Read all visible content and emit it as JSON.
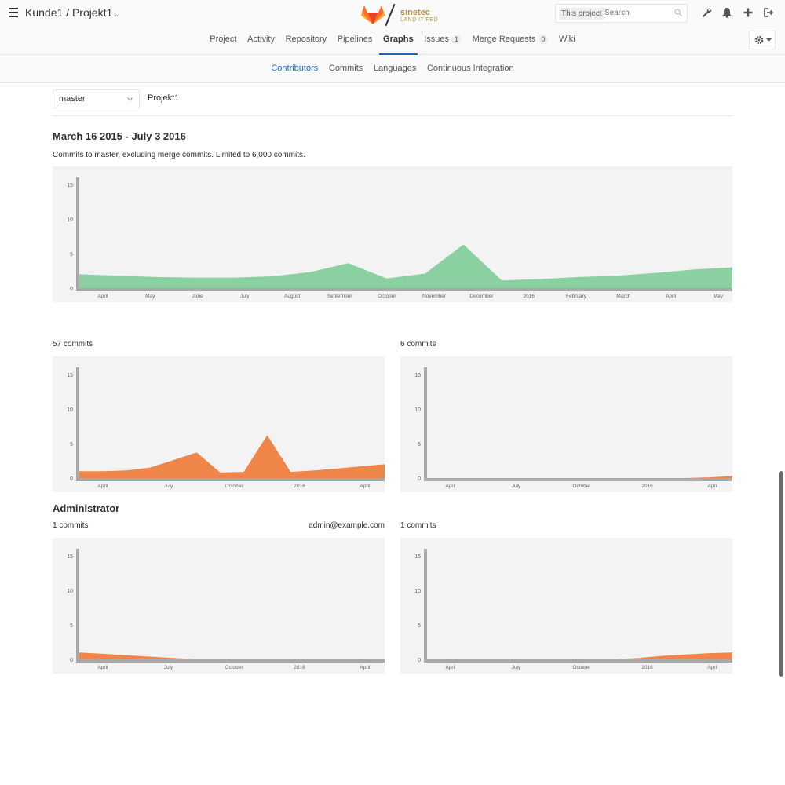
{
  "header": {
    "title": "Kunde1 / Projekt1",
    "brand": "sinetec",
    "brand_sub": "LAND IT FED",
    "search_scope": "This project",
    "search_placeholder": "Search",
    "nav": [
      {
        "label": "Project"
      },
      {
        "label": "Activity"
      },
      {
        "label": "Repository"
      },
      {
        "label": "Pipelines"
      },
      {
        "label": "Graphs",
        "active": true
      },
      {
        "label": "Issues",
        "badge": "1"
      },
      {
        "label": "Merge Requests",
        "badge": "0"
      },
      {
        "label": "Wiki"
      }
    ]
  },
  "subnav": {
    "items": [
      {
        "label": "Contributors",
        "active": true
      },
      {
        "label": "Commits"
      },
      {
        "label": "Languages"
      },
      {
        "label": "Continuous Integration"
      }
    ]
  },
  "branch": {
    "selected": "master",
    "project": "Projekt1"
  },
  "range_title": "March 16 2015 - July 3 2016",
  "range_desc": "Commits to master, excluding merge commits. Limited to 6,000 commits.",
  "colors": {
    "main": "#8ad0a0",
    "contrib": "#f0854a",
    "axis": "#a8a8a8",
    "bg": "#f3f3f3"
  },
  "contributors": [
    {
      "name": "",
      "commits": "57 commits",
      "email": ""
    },
    {
      "name": "",
      "commits": "6 commits",
      "email": ""
    },
    {
      "name": "Administrator",
      "commits": "1 commits",
      "email": "admin@example.com"
    },
    {
      "name": "",
      "commits": "1 commits",
      "email": ""
    }
  ],
  "chart_data": [
    {
      "type": "area",
      "x_ticks": [
        "April",
        "May",
        "June",
        "July",
        "August",
        "September",
        "October",
        "November",
        "December",
        "2016",
        "February",
        "March",
        "April",
        "May"
      ],
      "y_ticks": [
        "0",
        "5",
        "10",
        "15"
      ],
      "ylim": [
        0,
        16
      ],
      "series": [
        {
          "values": [
            2,
            1.8,
            1.6,
            1.5,
            1.5,
            1.7,
            2.3,
            3.6,
            1.4,
            2.1,
            6.3,
            1.1,
            1.3,
            1.6,
            1.8,
            2.2,
            2.7,
            3
          ]
        }
      ]
    },
    {
      "type": "area",
      "x_ticks": [
        "April",
        "July",
        "October",
        "2016",
        "April"
      ],
      "y_ticks": [
        "0",
        "5",
        "10",
        "15"
      ],
      "ylim": [
        0,
        16
      ],
      "series": [
        {
          "values": [
            1,
            1,
            1.1,
            1.5,
            2.6,
            3.7,
            0.8,
            0.9,
            6.2,
            0.9,
            1.1,
            1.4,
            1.7,
            2
          ]
        }
      ]
    },
    {
      "type": "area",
      "x_ticks": [
        "April",
        "July",
        "October",
        "2016",
        "April"
      ],
      "y_ticks": [
        "0",
        "5",
        "10",
        "15"
      ],
      "ylim": [
        0,
        16
      ],
      "series": [
        {
          "values": [
            0,
            0,
            0,
            0,
            0,
            0,
            0,
            0,
            0,
            0,
            0,
            0,
            0.1,
            0.3
          ]
        }
      ]
    },
    {
      "type": "area",
      "x_ticks": [
        "April",
        "July",
        "October",
        "2016",
        "April"
      ],
      "y_ticks": [
        "0",
        "5",
        "10",
        "15"
      ],
      "ylim": [
        0,
        16
      ],
      "series": [
        {
          "values": [
            1,
            0.8,
            0.6,
            0.4,
            0.2,
            0,
            0,
            0,
            0,
            0,
            0,
            0,
            0,
            0
          ]
        }
      ]
    },
    {
      "type": "area",
      "x_ticks": [
        "April",
        "July",
        "October",
        "2016",
        "April"
      ],
      "y_ticks": [
        "0",
        "5",
        "10",
        "15"
      ],
      "ylim": [
        0,
        16
      ],
      "series": [
        {
          "values": [
            0,
            0,
            0,
            0,
            0,
            0,
            0,
            0,
            0,
            0.2,
            0.5,
            0.7,
            0.9,
            1
          ]
        }
      ]
    }
  ]
}
